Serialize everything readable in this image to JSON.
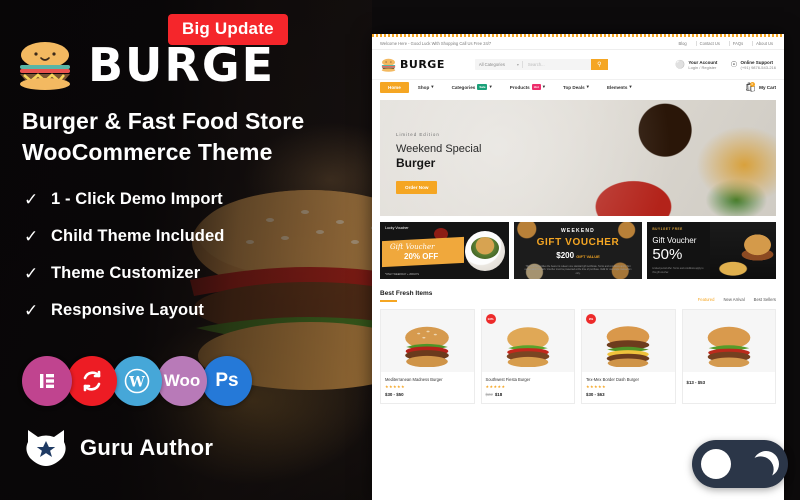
{
  "promo": {
    "update_badge": "Big Update",
    "brand_name": "BURGE",
    "brand_logo_icon": "burger-logo-icon",
    "headline_line1": "Burger & Fast Food Store",
    "headline_line2": "WooCommerce Theme",
    "features": [
      "1 - Click Demo Import",
      "Child Theme Included",
      "Theme Customizer",
      "Responsive Layout"
    ],
    "tech_icons": [
      {
        "name": "elementor-icon",
        "glyph": "≡",
        "color": "#c0448f"
      },
      {
        "name": "refresh-icon",
        "glyph": "↻",
        "color": "#ed1c24"
      },
      {
        "name": "wordpress-icon",
        "glyph": "Ⓦ",
        "color": "#46a7d8"
      },
      {
        "name": "woocommerce-icon",
        "glyph": "Woo",
        "color": "#b87ab8"
      },
      {
        "name": "photoshop-icon",
        "glyph": "Ps",
        "color": "#2579d8"
      }
    ],
    "author_label": "Guru Author",
    "author_icon": "cat-star-icon"
  },
  "site": {
    "topbar": {
      "welcome": "Welcome Here - Good Luck With Shopping Call Us Free 24/7",
      "links": [
        "Blog",
        "Contact Us",
        "FAQs",
        "About Us"
      ]
    },
    "header": {
      "logo_text": "BURGE",
      "category_select": "All Categories",
      "search_placeholder": "Search...",
      "search_icon": "search-icon",
      "account": {
        "icon": "user-icon",
        "title": "Your Account",
        "sub": "Login / Register"
      },
      "support": {
        "icon": "headset-icon",
        "title": "Online Support",
        "sub": "(+91) 9876-543-216"
      }
    },
    "nav": {
      "items": [
        {
          "label": "Home",
          "active": true,
          "caret": false,
          "badge": ""
        },
        {
          "label": "Shop",
          "active": false,
          "caret": true,
          "badge": ""
        },
        {
          "label": "Categories",
          "active": false,
          "caret": true,
          "badge": "Sale",
          "badge_kind": "sale"
        },
        {
          "label": "Products",
          "active": false,
          "caret": true,
          "badge": "Hot",
          "badge_kind": "hot"
        },
        {
          "label": "Top Deals",
          "active": false,
          "caret": true,
          "badge": ""
        },
        {
          "label": "Elements",
          "active": false,
          "caret": true,
          "badge": ""
        }
      ],
      "cart_label": "My Cart",
      "cart_count": "0",
      "cart_icon": "shopping-bag-icon"
    },
    "hero": {
      "kicker": "Limited Edition",
      "line1": "Weekend Special",
      "line2": "Burger",
      "button": "Order Now"
    },
    "vouchers": [
      {
        "tag": "Lucky Voucher",
        "title": "Gift Voucher",
        "value": "20% OFF",
        "footnote": "*ONLY WEEKDAY + 20DAYS"
      },
      {
        "kicker": "WEEKEND",
        "title": "GIFT VOUCHER",
        "value": "$200",
        "value_note": "GIFT VALUE",
        "footnote": "This voucher entitles the bearer to redeem one standard gift certificate. Terms and conditions apply. Not redeemable for cash. Voucher must be presented at the time of purchase. Valid for one single transaction only."
      },
      {
        "tag": "BUY1GET FREE",
        "title": "Gift Voucher",
        "value": "50%",
        "footnote": "Limited period offer. Terms and conditions apply to this gift voucher."
      }
    ],
    "products_section": {
      "title": "Best Fresh Items",
      "tabs": [
        {
          "label": "Featured",
          "active": true
        },
        {
          "label": "New Arrival",
          "active": false
        },
        {
          "label": "Best Sellers",
          "active": false
        }
      ],
      "items": [
        {
          "name": "Mediterranean Madness Burger",
          "stars": "★★★★★",
          "price": "$30 - $50",
          "old_price": "",
          "discount": ""
        },
        {
          "name": "Southwest Fiesta Burger",
          "stars": "★★★★★",
          "price": "$18",
          "old_price": "$22",
          "discount": "13%"
        },
        {
          "name": "Tex-Mex Border Dash Burger",
          "stars": "★★★★★",
          "price": "$30 - $63",
          "old_price": "",
          "discount": "9%"
        },
        {
          "name": "",
          "stars": "",
          "price": "$13 - $53",
          "old_price": "",
          "discount": ""
        }
      ]
    },
    "dark_mode_toggle": {
      "icon": "moon-icon",
      "state": "off"
    }
  }
}
